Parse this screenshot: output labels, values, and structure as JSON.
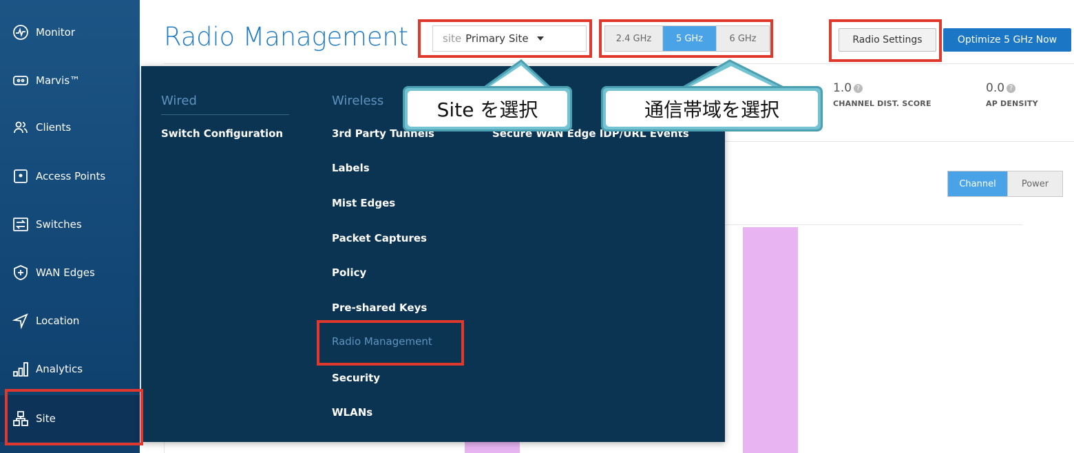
{
  "sidebar": {
    "items": [
      {
        "label": "Monitor",
        "icon": "monitor-icon"
      },
      {
        "label": "Marvis™",
        "icon": "marvis-icon"
      },
      {
        "label": "Clients",
        "icon": "clients-icon"
      },
      {
        "label": "Access Points",
        "icon": "access-point-icon"
      },
      {
        "label": "Switches",
        "icon": "switch-icon"
      },
      {
        "label": "WAN Edges",
        "icon": "wan-edge-icon"
      },
      {
        "label": "Location",
        "icon": "location-icon"
      },
      {
        "label": "Analytics",
        "icon": "analytics-icon"
      },
      {
        "label": "Site",
        "icon": "site-icon",
        "active": true
      }
    ]
  },
  "header": {
    "title": "Radio Management",
    "site_prefix": "site",
    "site_value": "Primary Site",
    "bands": [
      "2.4 GHz",
      "5 GHz",
      "6 GHz"
    ],
    "active_band": "5 GHz",
    "radio_settings": "Radio Settings",
    "optimize": "Optimize 5 GHz Now"
  },
  "metrics": [
    {
      "value": "1.0",
      "label": "CHANNEL DIST. SCORE"
    },
    {
      "value": "0.0",
      "label": "AP DENSITY"
    }
  ],
  "view_toggle": {
    "channel": "Channel",
    "power": "Power",
    "active": "Channel"
  },
  "dropdown": {
    "wired_heading": "Wired",
    "wired_items": [
      "Switch Configuration"
    ],
    "wireless_heading": "Wireless",
    "wireless_items": [
      "3rd Party Tunnels",
      "Labels",
      "Mist Edges",
      "Packet Captures",
      "Policy",
      "Pre-shared Keys",
      "Radio Management",
      "Security",
      "WLANs"
    ],
    "third_col_items": [
      "Secure WAN Edge IDP/URL Events"
    ],
    "current": "Radio Management"
  },
  "callouts": {
    "site": "Site を選択",
    "band": "通信帯域を選択"
  },
  "colors": {
    "highlight": "#e0382d",
    "accent": "#1b77c6",
    "callout_border": "#4a9fb0",
    "bar": "#e8b4f2"
  }
}
